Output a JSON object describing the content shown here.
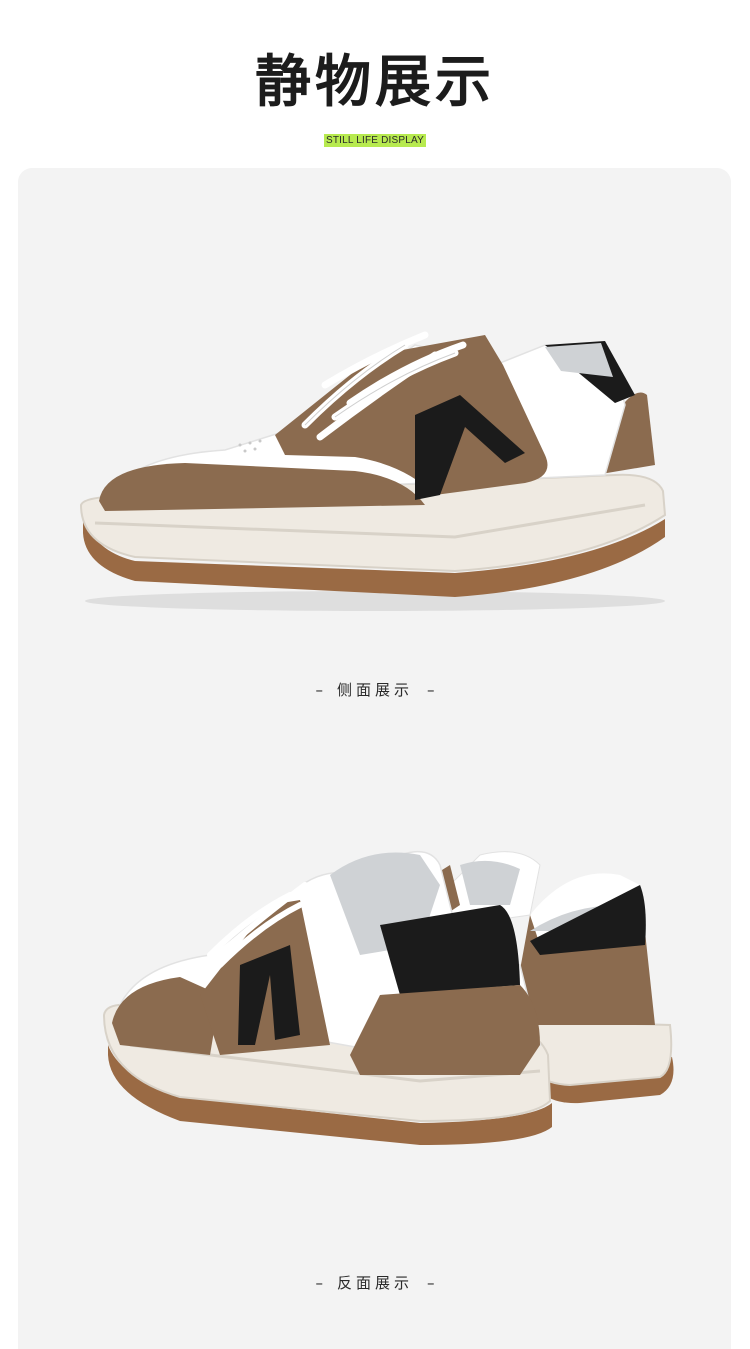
{
  "header": {
    "title": "静物展示",
    "subtitle": "STILL LIFE DISPLAY"
  },
  "sections": [
    {
      "caption": "侧面展示",
      "dash": "–"
    },
    {
      "caption": "反面展示",
      "dash": "–"
    }
  ],
  "colors": {
    "accent": "#b7ea4f",
    "panel": "#f3f3f3",
    "suede": "#8b6b4f",
    "leather": "#ffffff",
    "black_patch": "#1b1b1b",
    "sole": "#efeae2",
    "outsole": "#9a6a44"
  }
}
